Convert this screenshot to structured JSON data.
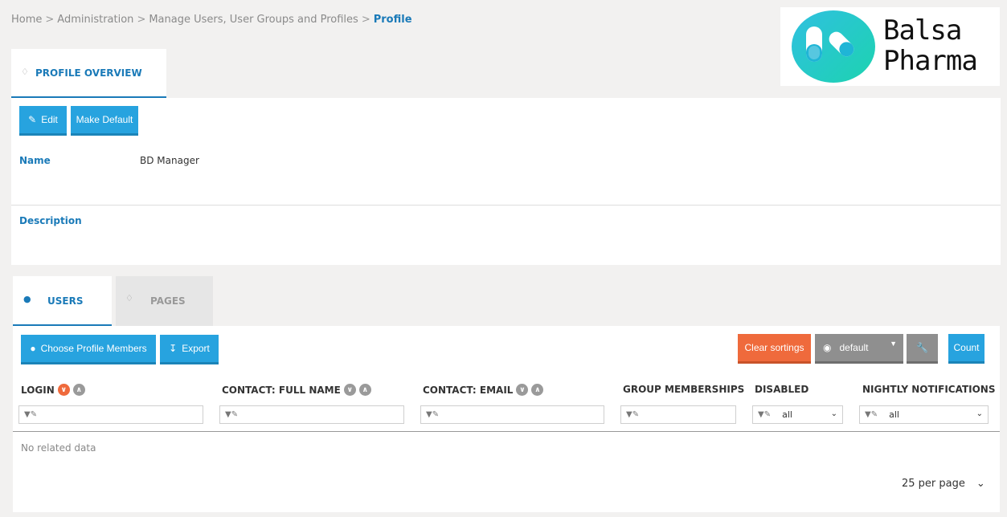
{
  "breadcrumb": [
    {
      "label": "Home"
    },
    {
      "label": "Administration"
    },
    {
      "label": "Manage Users, User Groups and Profiles"
    },
    {
      "label": "Profile",
      "current": true
    }
  ],
  "logo": {
    "line1": "Balsa",
    "line2": "Pharma"
  },
  "overview": {
    "tab_label": "PROFILE OVERVIEW",
    "edit_label": "Edit",
    "make_default_label": "Make Default",
    "name_label": "Name",
    "name_value": "BD Manager",
    "description_label": "Description"
  },
  "tabs": {
    "users": "USERS",
    "pages": "PAGES"
  },
  "toolbar": {
    "choose_members": "Choose Profile Members",
    "export": "Export",
    "clear_sortings": "Clear sortings",
    "view": "default",
    "count": "Count"
  },
  "columns": [
    {
      "label": "LOGIN"
    },
    {
      "label": "CONTACT: FULL NAME"
    },
    {
      "label": "CONTACT: EMAIL"
    },
    {
      "label": "GROUP MEMBERSHIPS"
    },
    {
      "label": "DISABLED",
      "filter_value": "all"
    },
    {
      "label": "NIGHTLY NOTIFICATIONS",
      "filter_value": "all"
    }
  ],
  "empty_text": "No related data",
  "per_page": "25 per page",
  "colors": {
    "accent": "#1a7ab8",
    "button": "#27a3df",
    "orange": "#ef6a3c"
  }
}
